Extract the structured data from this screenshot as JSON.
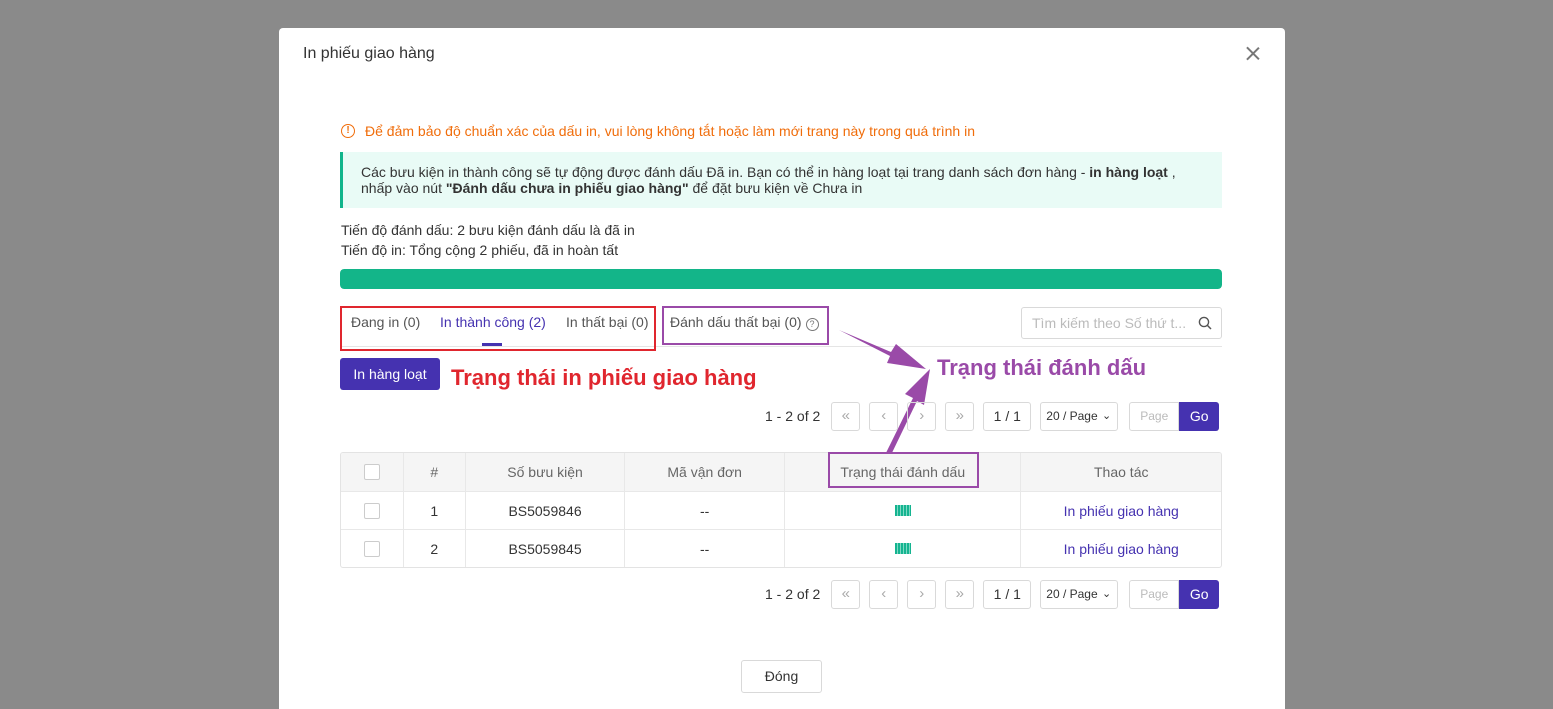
{
  "modal": {
    "title": "In phiếu giao hàng"
  },
  "warning": "Để đảm bảo độ chuẩn xác của dấu in, vui lòng không tắt hoặc làm mới trang này trong quá trình in",
  "info": {
    "part1": "Các bưu kiện in thành công sẽ tự động được đánh dấu Đã in. Bạn có thể in hàng loạt tại trang danh sách đơn hàng - ",
    "bold1": "in hàng loạt",
    "part2": " , nhấp vào nút ",
    "bold2": "\"Đánh dấu chưa in phiếu giao hàng\"",
    "part3": " để đặt bưu kiện về Chưa in"
  },
  "progress": {
    "mark_line": "Tiến độ đánh dấu: 2 bưu kiện đánh dấu là đã in",
    "print_line": "Tiến độ in: Tổng cộng 2 phiếu, đã in hoàn tất",
    "percent": 100
  },
  "tabs": {
    "printing": "Đang in (0)",
    "success": "In thành công (2)",
    "failed": "In thất bại (0)",
    "mark_failed": "Đánh dấu thất bại (0)"
  },
  "search": {
    "placeholder": "Tìm kiếm theo Số thứ t..."
  },
  "bulk_print_button": "In hàng loạt",
  "annotations": {
    "print_status": "Trạng thái in phiếu giao hàng",
    "mark_status": "Trạng thái đánh dấu"
  },
  "pagination": {
    "range": "1 - 2 of 2",
    "page": "1 / 1",
    "page_size": "20 / Page",
    "page_placeholder": "Page",
    "go": "Go"
  },
  "table": {
    "headers": [
      "",
      "#",
      "Số bưu kiện",
      "Mã vận đơn",
      "Trạng thái đánh dấu",
      "Thao tác"
    ],
    "rows": [
      {
        "index": "1",
        "parcel": "BS5059846",
        "tracking": "--",
        "action": "In phiếu giao hàng"
      },
      {
        "index": "2",
        "parcel": "BS5059845",
        "tracking": "--",
        "action": "In phiếu giao hàng"
      }
    ]
  },
  "close_button": "Đóng",
  "colors": {
    "primary": "#4532b0",
    "success": "#13b589",
    "warning": "#f06d0b",
    "annotation_red": "#e0262e",
    "annotation_purple": "#9a4aa8"
  }
}
